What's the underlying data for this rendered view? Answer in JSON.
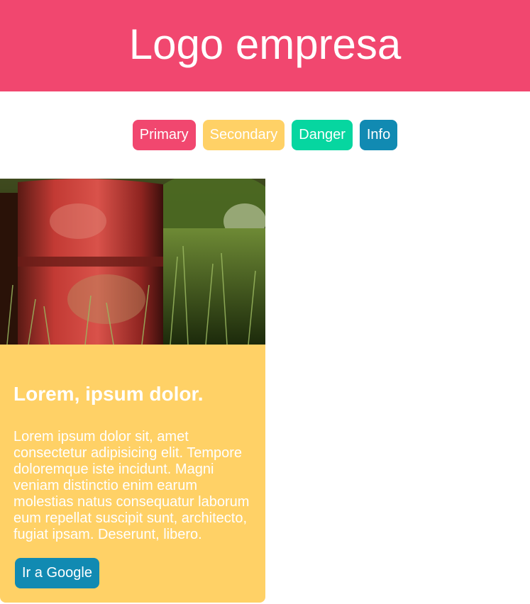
{
  "colors": {
    "primary": "#f1476f",
    "secondary": "#ffd166",
    "danger": "#06d6a0",
    "info": "#118ab2"
  },
  "header": {
    "logo_text": "Logo empresa"
  },
  "buttons": [
    {
      "label": "Primary",
      "variant": "primary"
    },
    {
      "label": "Secondary",
      "variant": "secondary"
    },
    {
      "label": "Danger",
      "variant": "danger"
    },
    {
      "label": "Info",
      "variant": "info"
    }
  ],
  "card": {
    "image": "red-rusted-barrel-in-grass",
    "title": "Lorem, ipsum dolor.",
    "text": "Lorem ipsum dolor sit, amet consectetur adipisicing elit. Tempore doloremque iste incidunt. Magni veniam distinctio enim earum molestias natus consequatur laborum eum repellat suscipit sunt, architecto, fugiat ipsam. Deserunt, libero.",
    "button_label": "Ir a Google"
  }
}
